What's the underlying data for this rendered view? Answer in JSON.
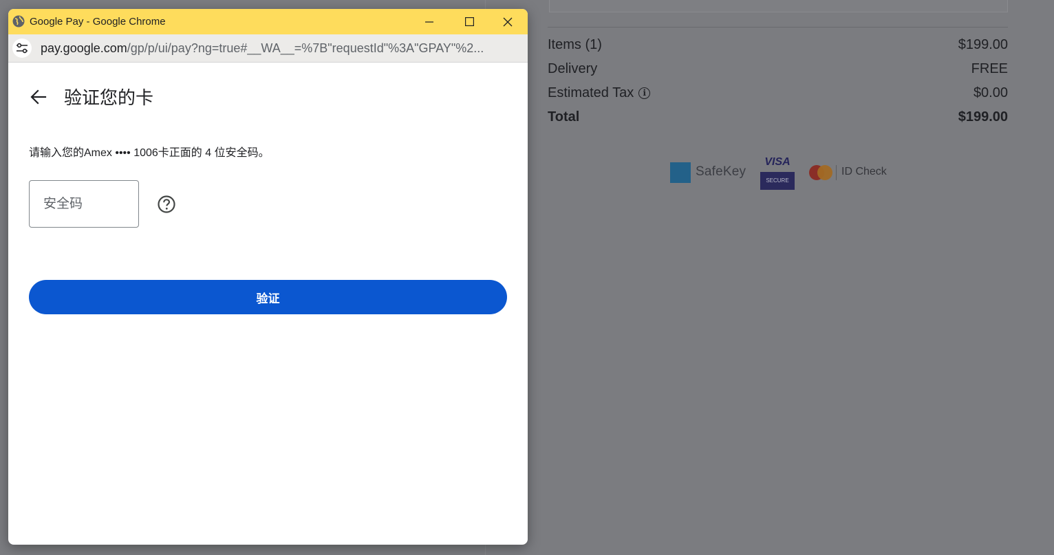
{
  "popup": {
    "window_title": "Google Pay - Google Chrome",
    "url_host": "pay.google.com",
    "url_rest": "/gp/p/ui/pay?ng=true#__WA__=%7B\"requestId\"%3A\"GPAY\"%2...",
    "titlebar_color": "#fedc5c"
  },
  "verify": {
    "title": "验证您的卡",
    "instruction": "请输入您的Amex •••• 1006卡正面的 4 位安全码。",
    "cvc_placeholder": "安全码",
    "button_label": "验证",
    "button_color": "#0b57d0"
  },
  "summary": {
    "items_label": "Items (1)",
    "items_value": "$199.00",
    "delivery_label": "Delivery",
    "delivery_value": "FREE",
    "tax_label": "Estimated Tax",
    "tax_value": "$0.00",
    "total_label": "Total",
    "total_value": "$199.00"
  },
  "badges": {
    "amex_text": "SafeKey",
    "visa_top": "VISA",
    "visa_bottom": "SECURE",
    "mc_text": "ID Check"
  }
}
